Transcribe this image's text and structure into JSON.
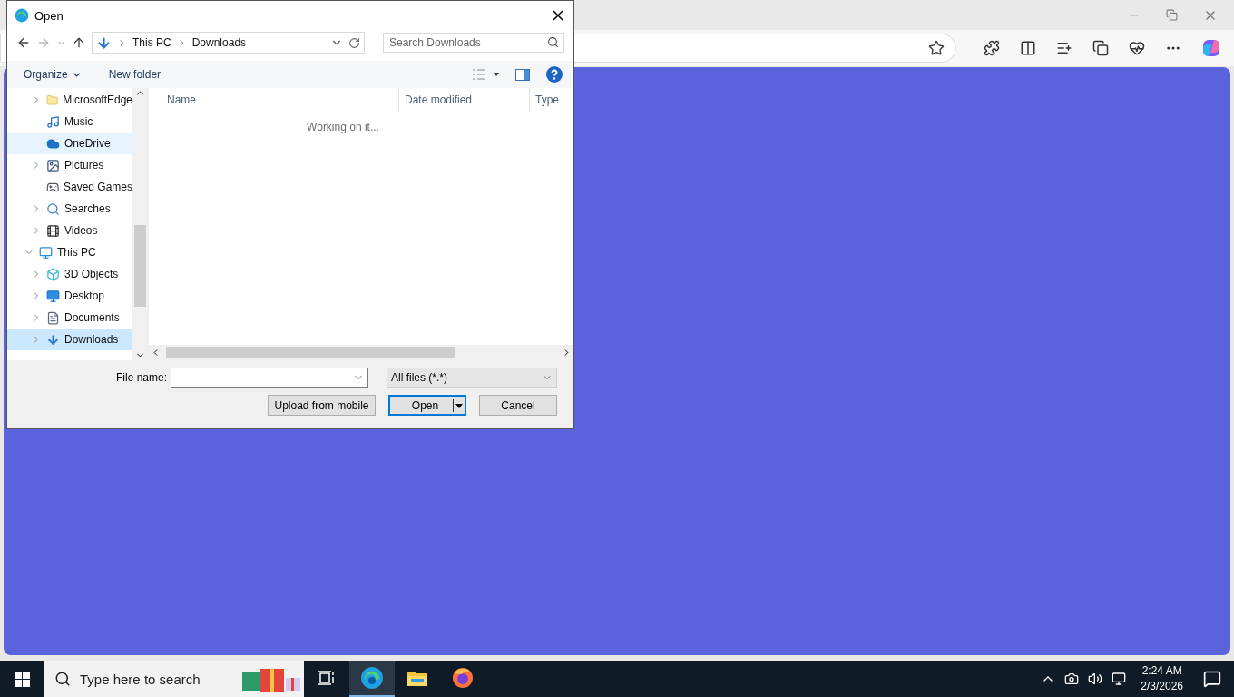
{
  "dialog": {
    "title": "Open",
    "breadcrumb": [
      "This PC",
      "Downloads"
    ],
    "search": {
      "placeholder": "Search Downloads"
    },
    "toolbar": [
      "Organize",
      "New folder"
    ],
    "nav_tree": [
      {
        "children": [
          {
            "label": "MicrosoftEdge",
            "kind": "folder",
            "expandable": true,
            "hovered": false,
            "selected": false
          },
          {
            "label": "Music",
            "kind": "music",
            "expandable": false,
            "hovered": false,
            "selected": false
          },
          {
            "label": "OneDrive",
            "kind": "cloud",
            "expandable": false,
            "hovered": true,
            "selected": false
          },
          {
            "label": "Pictures",
            "kind": "pictures",
            "expandable": true,
            "hovered": false,
            "selected": false
          },
          {
            "label": "Saved Games",
            "kind": "games",
            "expandable": false,
            "hovered": false,
            "selected": false
          },
          {
            "label": "Searches",
            "kind": "search",
            "expandable": true,
            "hovered": false,
            "selected": false
          },
          {
            "label": "Videos",
            "kind": "video",
            "expandable": true,
            "hovered": false,
            "selected": false
          }
        ]
      },
      {
        "label": "This PC",
        "kind": "pc",
        "expandable": true,
        "expanded": true,
        "hovered": false,
        "selected": false,
        "children": [
          {
            "label": "3D Objects",
            "kind": "cube",
            "expandable": true,
            "hovered": false,
            "selected": false
          },
          {
            "label": "Desktop",
            "kind": "desktop",
            "expandable": true,
            "hovered": false,
            "selected": false
          },
          {
            "label": "Documents",
            "kind": "documents",
            "expandable": true,
            "hovered": false,
            "selected": false
          },
          {
            "label": "Downloads",
            "kind": "download",
            "expandable": true,
            "hovered": false,
            "selected": true
          }
        ]
      }
    ],
    "columns": [
      "Name",
      "Date modified",
      "Type"
    ],
    "status": "Working on it...",
    "file_name_label": "File name:",
    "file_type": "All files (*.*)",
    "buttons": [
      {
        "label": "Upload from mobile",
        "kind": "plain",
        "default": false
      },
      {
        "label": "Open",
        "kind": "split",
        "default": true
      },
      {
        "label": "Cancel",
        "kind": "plain",
        "default": false
      }
    ]
  },
  "taskbar": {
    "search_placeholder": "Type here to search",
    "apps": [
      {
        "kind": "taskview",
        "active": false
      },
      {
        "kind": "edge",
        "active": true
      },
      {
        "kind": "explorer",
        "active": false
      },
      {
        "kind": "firefox",
        "active": false
      }
    ],
    "time": "2:24 AM",
    "date": "2/3/2026"
  }
}
